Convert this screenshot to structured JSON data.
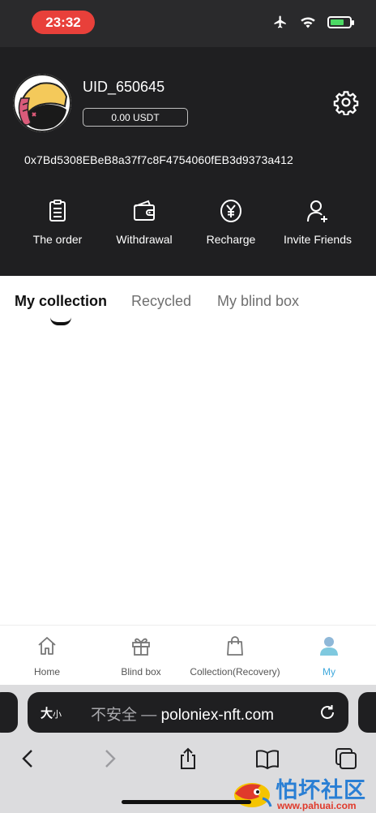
{
  "status_bar": {
    "time": "23:32",
    "icons": [
      "airplane-icon",
      "wifi-icon",
      "battery-charging-icon"
    ],
    "colors": {
      "time_pill": "#e8403a",
      "battery": "#4cd964"
    }
  },
  "profile": {
    "uid": "UID_650645",
    "balance": "0.00 USDT",
    "address": "0x7Bd5308EBeB8a37f7c8F4754060fEB3d9373a412"
  },
  "actions": [
    {
      "label": "The order",
      "icon": "clipboard-icon"
    },
    {
      "label": "Withdrawal",
      "icon": "wallet-icon"
    },
    {
      "label": "Recharge",
      "icon": "yen-coin-icon"
    },
    {
      "label": "Invite Friends",
      "icon": "add-user-icon"
    }
  ],
  "tabs": [
    {
      "label": "My collection",
      "active": true
    },
    {
      "label": "Recycled",
      "active": false
    },
    {
      "label": "My blind box",
      "active": false
    }
  ],
  "bottom_nav": [
    {
      "label": "Home",
      "icon": "home-icon",
      "active": false
    },
    {
      "label": "Blind box",
      "icon": "gift-icon",
      "active": false
    },
    {
      "label": "Collection(Recovery)",
      "icon": "shopping-bag-icon",
      "active": false
    },
    {
      "label": "My",
      "icon": "user-icon",
      "active": true
    }
  ],
  "browser": {
    "text_size_big": "大",
    "text_size_small": "小",
    "insecure_label": "不安全 —",
    "domain": "poloniex-nft.com",
    "toolbar_icons": [
      "back-icon",
      "forward-icon",
      "share-icon",
      "bookmarks-icon",
      "tabs-icon"
    ]
  },
  "watermark": {
    "text": "怕坏社区",
    "url": "www.pahuai.com"
  },
  "colors": {
    "header_bg": "#1f1f21",
    "accent": "#3fa9dd",
    "tab_active": "#111111",
    "tab_inactive": "#6f6f6f"
  }
}
